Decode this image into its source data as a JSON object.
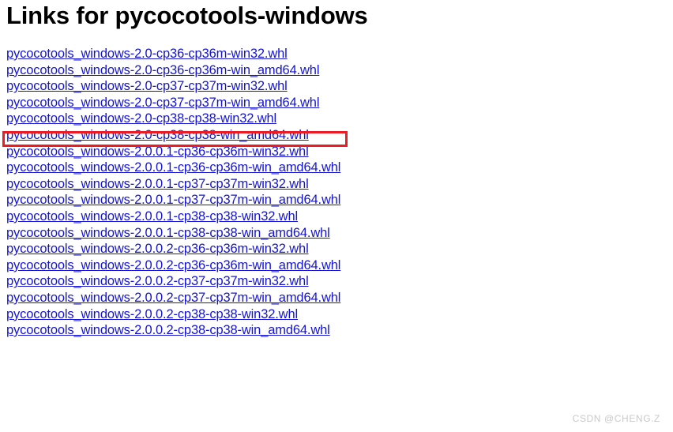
{
  "page": {
    "title": "Links for pycocotools-windows",
    "background_color": "#ffffff",
    "link_color": "#1414d2",
    "highlight_color": "#ed1c24"
  },
  "links": [
    {
      "label": "pycocotools_windows-2.0-cp36-cp36m-win32.whl"
    },
    {
      "label": "pycocotools_windows-2.0-cp36-cp36m-win_amd64.whl"
    },
    {
      "label": "pycocotools_windows-2.0-cp37-cp37m-win32.whl"
    },
    {
      "label": "pycocotools_windows-2.0-cp37-cp37m-win_amd64.whl"
    },
    {
      "label": "pycocotools_windows-2.0-cp38-cp38-win32.whl"
    },
    {
      "label": "pycocotools_windows-2.0-cp38-cp38-win_amd64.whl"
    },
    {
      "label": "pycocotools_windows-2.0.0.1-cp36-cp36m-win32.whl"
    },
    {
      "label": "pycocotools_windows-2.0.0.1-cp36-cp36m-win_amd64.whl"
    },
    {
      "label": "pycocotools_windows-2.0.0.1-cp37-cp37m-win32.whl"
    },
    {
      "label": "pycocotools_windows-2.0.0.1-cp37-cp37m-win_amd64.whl"
    },
    {
      "label": "pycocotools_windows-2.0.0.1-cp38-cp38-win32.whl"
    },
    {
      "label": "pycocotools_windows-2.0.0.1-cp38-cp38-win_amd64.whl"
    },
    {
      "label": "pycocotools_windows-2.0.0.2-cp36-cp36m-win32.whl"
    },
    {
      "label": "pycocotools_windows-2.0.0.2-cp36-cp36m-win_amd64.whl"
    },
    {
      "label": "pycocotools_windows-2.0.0.2-cp37-cp37m-win32.whl"
    },
    {
      "label": "pycocotools_windows-2.0.0.2-cp37-cp37m-win_amd64.whl"
    },
    {
      "label": "pycocotools_windows-2.0.0.2-cp38-cp38-win32.whl"
    },
    {
      "label": "pycocotools_windows-2.0.0.2-cp38-cp38-win_amd64.whl"
    }
  ],
  "highlight": {
    "target_index": 5,
    "target_label": "pycocotools_windows-2.0-cp38-cp38-win_amd64.whl"
  },
  "watermark": {
    "text": "CSDN @CHENG.Z"
  }
}
